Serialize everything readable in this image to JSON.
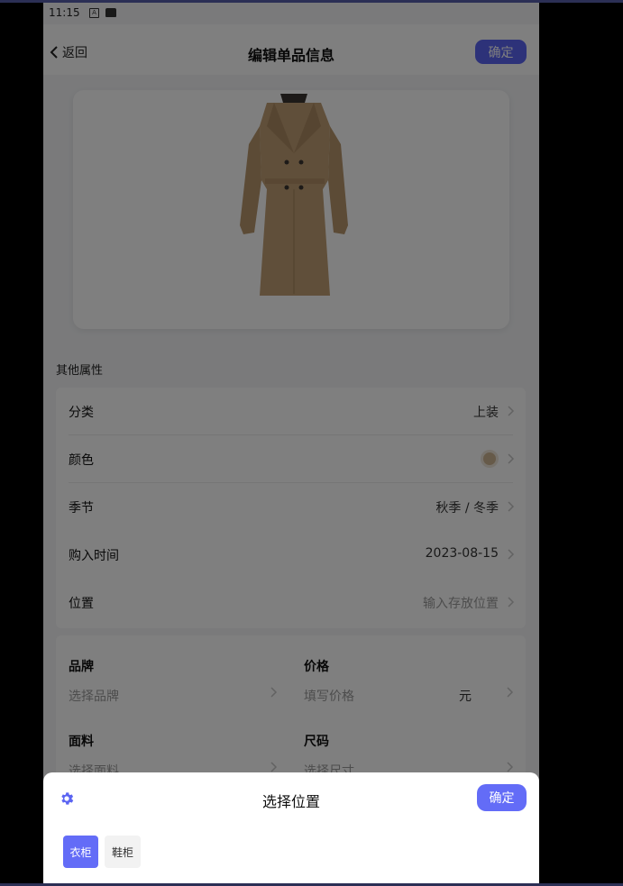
{
  "status_bar": {
    "time": "11:15",
    "icons": [
      "a-icon",
      "sdcard-icon"
    ]
  },
  "navbar": {
    "back_label": "返回",
    "title": "编辑单品信息",
    "confirm_label": "确定"
  },
  "item_photo": {
    "description_icon": "coat-image"
  },
  "section_label": "其他属性",
  "attributes": [
    {
      "label": "分类",
      "value": "上装"
    },
    {
      "label": "颜色",
      "value": "",
      "swatch": "#cdb592"
    },
    {
      "label": "季节",
      "value": "秋季 / 冬季"
    },
    {
      "label": "购入时间",
      "value": "2023-08-15"
    },
    {
      "label": "位置",
      "placeholder": "输入存放位置"
    }
  ],
  "details": {
    "brand": {
      "title": "品牌",
      "placeholder": "选择品牌"
    },
    "price": {
      "title": "价格",
      "placeholder": "填写价格",
      "unit": "元"
    },
    "fabric": {
      "title": "面料",
      "placeholder": "选择面料"
    },
    "size": {
      "title": "尺码",
      "placeholder": "选择尺寸"
    }
  },
  "sheet": {
    "title": "选择位置",
    "confirm_label": "确定",
    "options": [
      {
        "label": "衣柜",
        "selected": true
      },
      {
        "label": "鞋柜",
        "selected": false
      }
    ]
  },
  "colors": {
    "accent": "#5b64f2",
    "overlay": "rgba(0,0,0,0.5)"
  }
}
